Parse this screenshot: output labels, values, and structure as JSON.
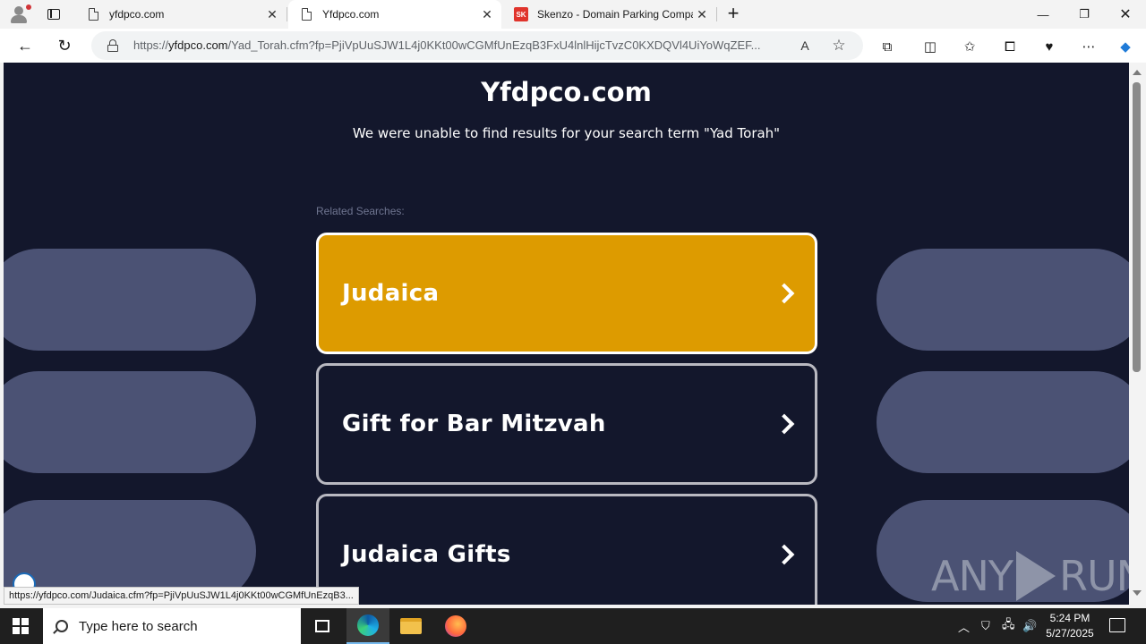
{
  "browser": {
    "tabs": [
      {
        "title": "yfdpco.com",
        "icon": "document-icon"
      },
      {
        "title": "Yfdpco.com",
        "icon": "document-icon"
      },
      {
        "title": "Skenzo - Domain Parking Compa",
        "icon": "skenzo-icon",
        "icon_text": "SK"
      }
    ],
    "url_prefix": "https://",
    "url_domain": "yfdpco.com",
    "url_rest": "/Yad_Torah.cfm?fp=PjiVpUuSJW1L4j0KKt00wCGMfUnEzqB3FxU4lnlHijcTvzC0KXDQVl4UiYoWqZEF...",
    "status_url": "https://yfdpco.com/Judaica.cfm?fp=PjiVpUuSJW1L4j0KKt00wCGMfUnEzqB3..."
  },
  "page": {
    "title": "Yfdpco.com",
    "subtitle": "We were unable to find results for your search term \"Yad Torah\"",
    "related_label": "Related Searches:",
    "searches": [
      {
        "label": "Judaica",
        "active": true
      },
      {
        "label": "Gift for Bar Mitzvah",
        "active": false
      },
      {
        "label": "Judaica Gifts",
        "active": false
      }
    ],
    "watermark": {
      "left": "ANY",
      "right": "RUN"
    }
  },
  "taskbar": {
    "search_placeholder": "Type here to search",
    "time": "5:24 PM",
    "date": "5/27/2025"
  },
  "colors": {
    "page_bg": "#13172c",
    "active_button": "#dd9b00",
    "pill": "#4b5274"
  }
}
